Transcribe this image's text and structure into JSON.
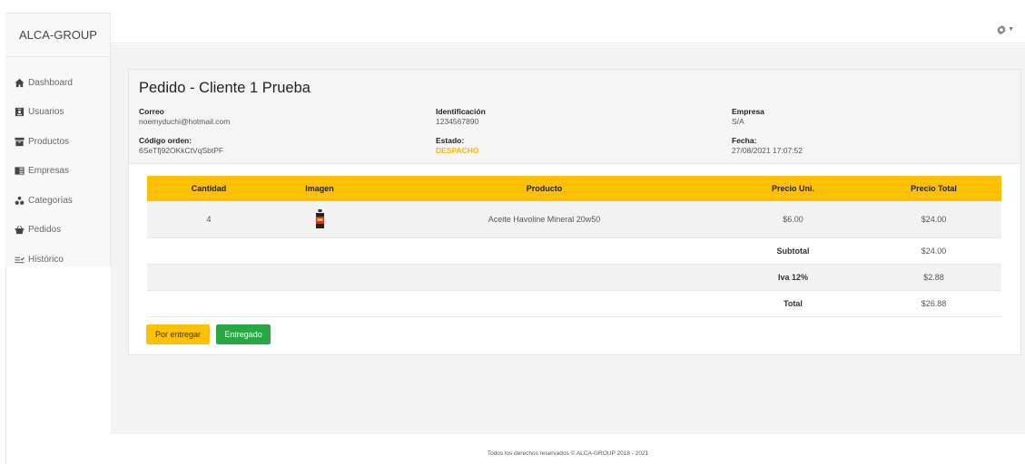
{
  "brand": "ALCA-GROUP",
  "nav": [
    {
      "label": "Dashboard",
      "icon": "home-icon"
    },
    {
      "label": "Usuarios",
      "icon": "user-card-icon"
    },
    {
      "label": "Productos",
      "icon": "archive-icon"
    },
    {
      "label": "Empresas",
      "icon": "building-icon"
    },
    {
      "label": "Categorías",
      "icon": "categories-icon"
    },
    {
      "label": "Pedidos",
      "icon": "basket-icon"
    },
    {
      "label": "Histórico",
      "icon": "history-icon"
    }
  ],
  "order": {
    "title": "Pedido - Cliente 1 Prueba",
    "correo_label": "Correo",
    "correo": "noemyduchi@hotmail.com",
    "identificacion_label": "Identificación",
    "identificacion": "1234567890",
    "empresa_label": "Empresa",
    "empresa": "S/A",
    "codigo_label": "Código orden:",
    "codigo": "6SeTfj92OKkCtVqSbtPF",
    "estado_label": "Estado:",
    "estado": "DESPACHO",
    "fecha_label": "Fecha:",
    "fecha": "27/08/2021 17:07:52"
  },
  "table": {
    "headers": [
      "Cantidad",
      "Imagen",
      "Producto",
      "Precio Uni.",
      "Precio Total"
    ],
    "rows": [
      {
        "cantidad": "4",
        "imagen": "product-bottle",
        "producto": "Aceite Havoline Mineral 20w50",
        "precio_uni": "$6.00",
        "precio_total": "$24.00"
      }
    ],
    "subtotal_label": "Subtotal",
    "subtotal": "$24.00",
    "iva_label": "Iva 12%",
    "iva": "$2.88",
    "total_label": "Total",
    "total": "$26.88"
  },
  "buttons": {
    "por_entregar": "Por entregar",
    "entregado": "Entregado"
  },
  "footer": "Todos los derechos reservados © ALCA-GROUP 2018 - 2021",
  "colors": {
    "accent": "#ffc107",
    "success": "#28a745",
    "status": "#f5b800"
  }
}
